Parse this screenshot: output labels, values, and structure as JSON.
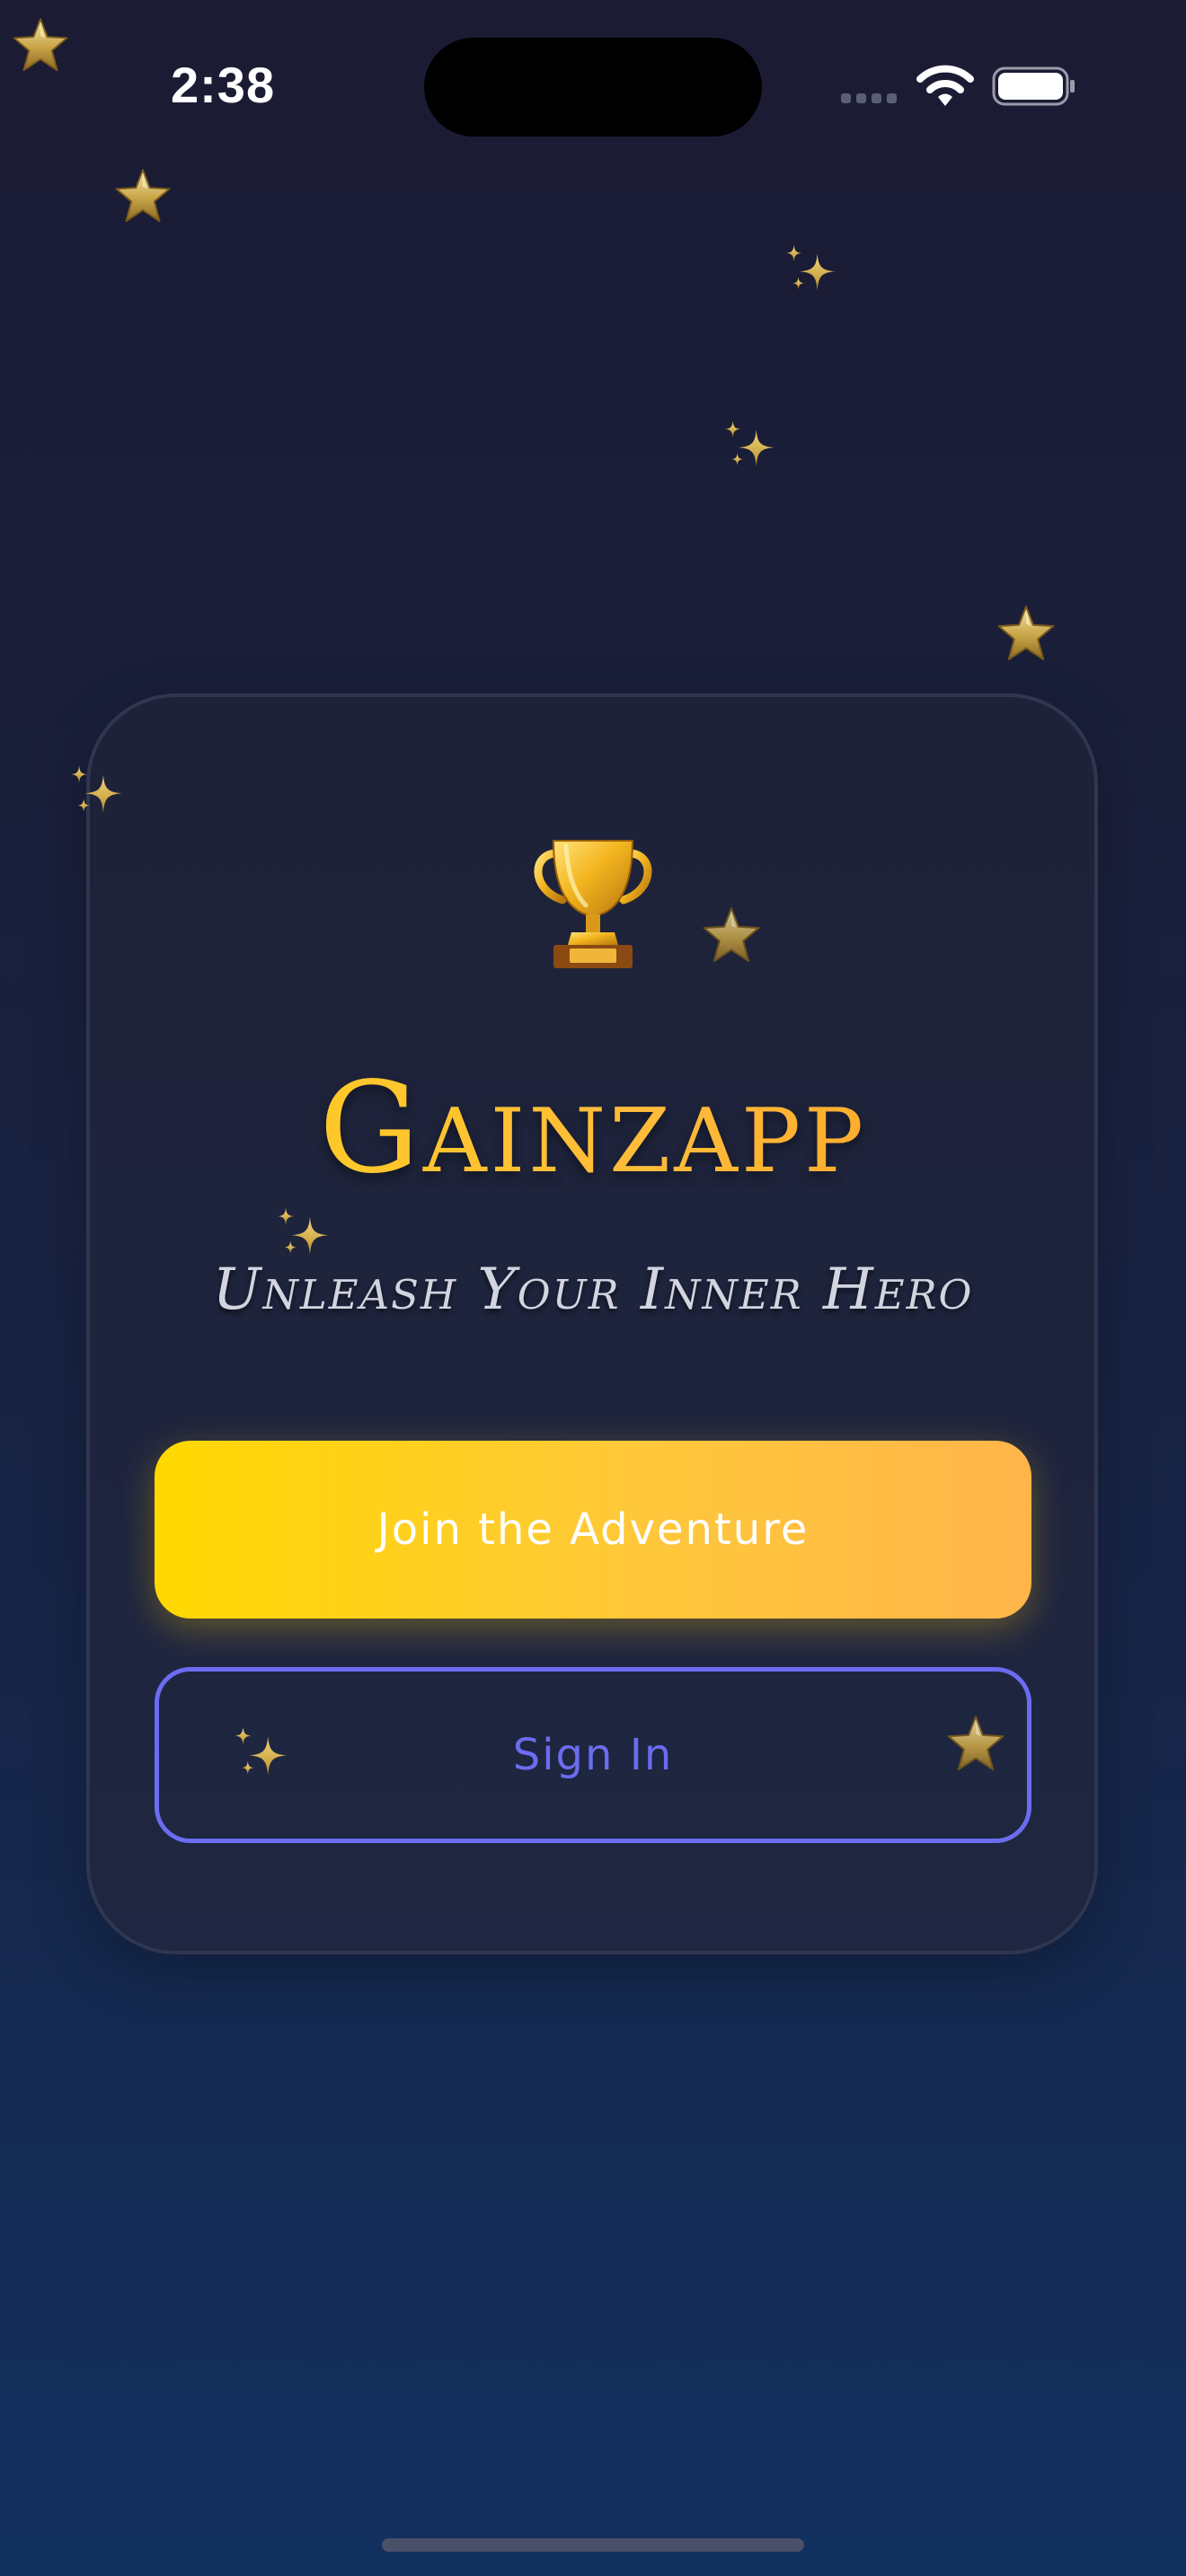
{
  "status_bar": {
    "time": "2:38"
  },
  "app": {
    "title": "Gainzapp",
    "tagline": "Unleash Your Inner Hero"
  },
  "actions": {
    "primary_label": "Join the Adventure",
    "secondary_label": "Sign In"
  },
  "icons": {
    "trophy": "trophy-icon",
    "star": "star-icon",
    "sparkles": "sparkles-icon"
  },
  "colors": {
    "background_top": "#1b1b33",
    "background_bottom": "#12305e",
    "title_gradient_start": "#ffd619",
    "title_gradient_end": "#ff9a1d",
    "primary_button_start": "#ffd900",
    "primary_button_end": "#ffb54a",
    "secondary_accent": "#6b6cf0"
  }
}
